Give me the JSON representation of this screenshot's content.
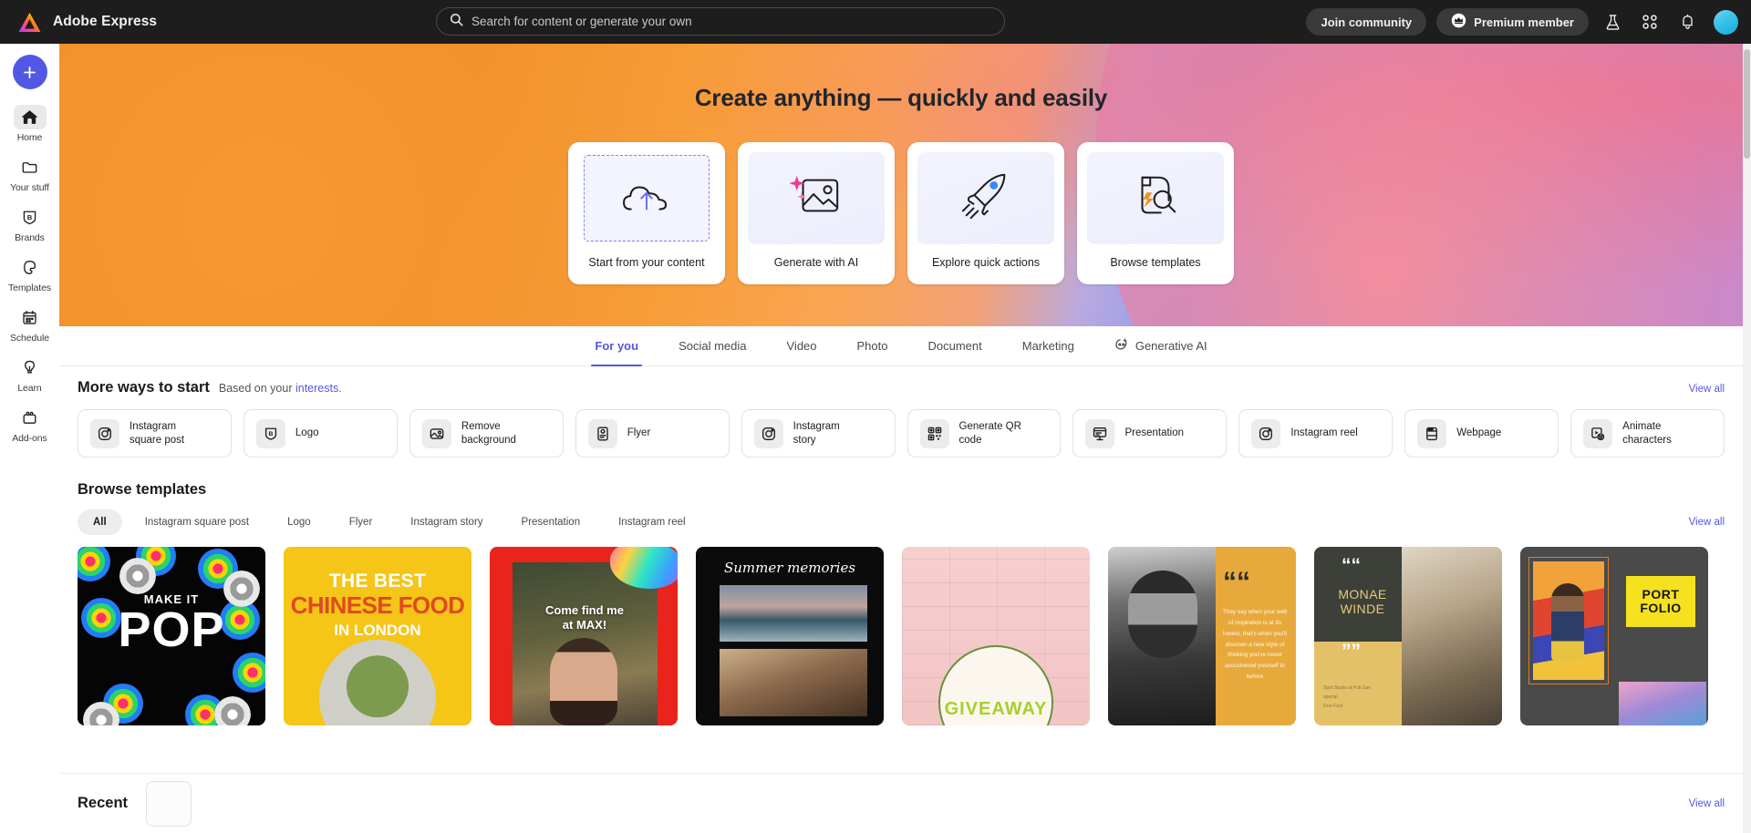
{
  "header": {
    "brand": "Adobe Express",
    "brand_logo_icon": "adobe-express-logo",
    "search": {
      "icon": "search-icon",
      "placeholder": "Search for content or generate your own",
      "value": ""
    },
    "join_community_label": "Join community",
    "premium_label": "Premium member",
    "premium_icon": "crown-badge-icon",
    "icons": [
      "beaker-icon",
      "apps-grid-icon",
      "bell-icon"
    ],
    "avatar_icon": "user-avatar"
  },
  "sidebar": {
    "create_button": {
      "label": "+",
      "icon": "plus-icon"
    },
    "items": [
      {
        "label": "Home",
        "icon": "home-icon",
        "active": true
      },
      {
        "label": "Your stuff",
        "icon": "folder-icon",
        "active": false
      },
      {
        "label": "Brands",
        "icon": "brand-shield-icon",
        "active": false
      },
      {
        "label": "Templates",
        "icon": "templates-icon",
        "active": false
      },
      {
        "label": "Schedule",
        "icon": "calendar-icon",
        "active": false
      },
      {
        "label": "Learn",
        "icon": "lightbulb-icon",
        "active": false
      },
      {
        "label": "Add-ons",
        "icon": "addons-icon",
        "active": false
      }
    ]
  },
  "hero": {
    "title": "Create anything — quickly and easily",
    "cards": [
      {
        "label": "Start from your content",
        "icon": "cloud-upload-icon"
      },
      {
        "label": "Generate with AI",
        "icon": "sparkle-image-icon"
      },
      {
        "label": "Explore quick actions",
        "icon": "rocket-icon"
      },
      {
        "label": "Browse templates",
        "icon": "document-search-icon"
      }
    ]
  },
  "tabs": [
    {
      "label": "For you",
      "active": true,
      "icon": ""
    },
    {
      "label": "Social media",
      "active": false,
      "icon": ""
    },
    {
      "label": "Video",
      "active": false,
      "icon": ""
    },
    {
      "label": "Photo",
      "active": false,
      "icon": ""
    },
    {
      "label": "Document",
      "active": false,
      "icon": ""
    },
    {
      "label": "Marketing",
      "active": false,
      "icon": ""
    },
    {
      "label": "Generative AI",
      "active": false,
      "icon": "generative-ai-icon"
    }
  ],
  "more_ways": {
    "title": "More ways to start",
    "subtitle_prefix": "Based on your ",
    "subtitle_link": "interests.",
    "view_all": "View all",
    "chips": [
      {
        "label": "Instagram\nsquare post",
        "icon": "instagram-icon"
      },
      {
        "label": "Logo",
        "icon": "brand-shield-icon"
      },
      {
        "label": "Remove\nbackground",
        "icon": "image-icon"
      },
      {
        "label": "Flyer",
        "icon": "flyer-icon"
      },
      {
        "label": "Instagram\nstory",
        "icon": "instagram-icon"
      },
      {
        "label": "Generate QR\ncode",
        "icon": "qr-code-icon"
      },
      {
        "label": "Presentation",
        "icon": "presentation-icon"
      },
      {
        "label": "Instagram reel",
        "icon": "instagram-icon"
      },
      {
        "label": "Webpage",
        "icon": "webpage-icon"
      },
      {
        "label": "Animate\ncharacters",
        "icon": "animate-characters-icon"
      }
    ]
  },
  "browse_templates": {
    "title": "Browse templates",
    "view_all": "View all",
    "filters": [
      {
        "label": "All",
        "active": true
      },
      {
        "label": "Instagram square post",
        "active": false
      },
      {
        "label": "Logo",
        "active": false
      },
      {
        "label": "Flyer",
        "active": false
      },
      {
        "label": "Instagram story",
        "active": false
      },
      {
        "label": "Presentation",
        "active": false
      },
      {
        "label": "Instagram reel",
        "active": false
      }
    ],
    "templates": [
      {
        "name": "make-it-pop",
        "line1": "MAKE IT",
        "line2": "POP"
      },
      {
        "name": "chinese-food",
        "line1": "THE BEST",
        "line2": "CHINESE FOOD",
        "line3": "IN LONDON"
      },
      {
        "name": "come-find-me-at-max",
        "caption": "Come find me\nat MAX!"
      },
      {
        "name": "summer-memories",
        "title": "Summer memories"
      },
      {
        "name": "giveaway",
        "word": "GIVEAWAY"
      },
      {
        "name": "inspiration-quote",
        "quote": "They say when your well of inspiration is at its lowest, that's when you'll discover a new style of thinking you've never accustomed yourself to before"
      },
      {
        "name": "monae-winde-quote",
        "quote_mark": "“",
        "quote_mark_close": "”",
        "person": "MONAE\nWINDE",
        "small_text": "Spot Studio at Pub San\nspecial\nFine Font"
      },
      {
        "name": "portfolio",
        "line1": "PORT",
        "line2": "FOLIO"
      }
    ]
  },
  "recent": {
    "title": "Recent",
    "view_all": "View all"
  },
  "colors": {
    "accent": "#5258e4",
    "header_bg": "#1d1d1d",
    "hero_orange": "#f3922a",
    "hero_purple": "#96a0f3"
  }
}
